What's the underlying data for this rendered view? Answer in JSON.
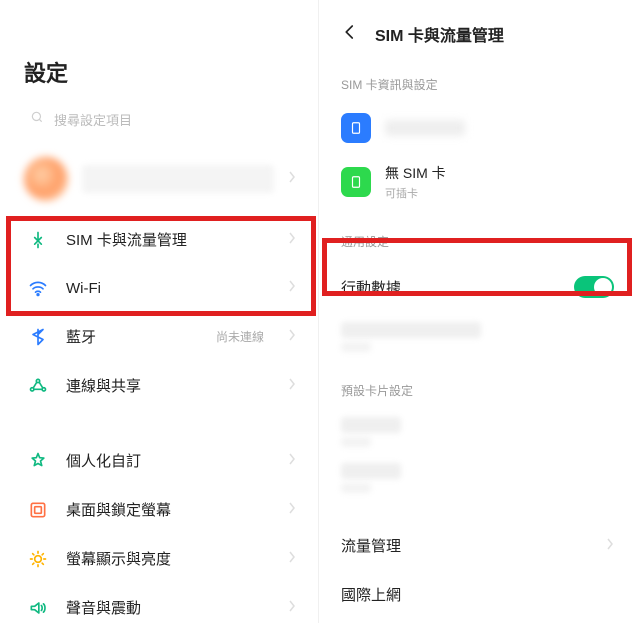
{
  "left": {
    "title": "設定",
    "search_placeholder": "搜尋設定項目",
    "menu": [
      {
        "key": "sim",
        "label": "SIM 卡與流量管理",
        "status": ""
      },
      {
        "key": "wifi",
        "label": "Wi-Fi",
        "status": ""
      },
      {
        "key": "bluetooth",
        "label": "藍牙",
        "status": "尚未連線"
      },
      {
        "key": "tether",
        "label": "連線與共享",
        "status": ""
      },
      {
        "key": "personal",
        "label": "個人化自訂",
        "status": ""
      },
      {
        "key": "lockscreen",
        "label": "桌面與鎖定螢幕",
        "status": ""
      },
      {
        "key": "display",
        "label": "螢幕顯示與亮度",
        "status": ""
      },
      {
        "key": "sound",
        "label": "聲音與震動",
        "status": ""
      }
    ]
  },
  "right": {
    "title": "SIM 卡與流量管理",
    "section_sim": "SIM 卡資訊與設定",
    "sim_slots": [
      {
        "title": "",
        "sub": ""
      },
      {
        "title": "無 SIM 卡",
        "sub": "可插卡"
      }
    ],
    "section_general": "通用設定",
    "mobile_data_label": "行動數據",
    "mobile_data_on": true,
    "section_default": "預設卡片設定",
    "traffic_label": "流量管理",
    "roaming_label": "國際上網"
  }
}
